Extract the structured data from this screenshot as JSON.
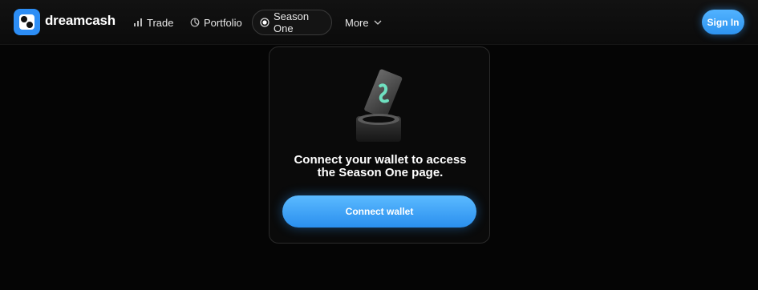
{
  "brand": {
    "name": "dreamcash"
  },
  "nav": {
    "items": [
      {
        "label": "Trade",
        "icon": "bar-chart-icon"
      },
      {
        "label": "Portfolio",
        "icon": "pie-chart-icon"
      },
      {
        "label": "Season One",
        "icon": "record-dot-icon",
        "active": true
      },
      {
        "label": "More",
        "icon": "chevron-down-icon"
      }
    ],
    "signin_label": "Sign In"
  },
  "card": {
    "illustration": "ticket-into-slot-icon",
    "message_line1": "Connect your wallet to access",
    "message_line2": "the Season One page.",
    "button_label": "Connect wallet"
  },
  "colors": {
    "accent": "#2d93f0",
    "background": "#050505",
    "ticket_mark": "#6fe0c0"
  }
}
